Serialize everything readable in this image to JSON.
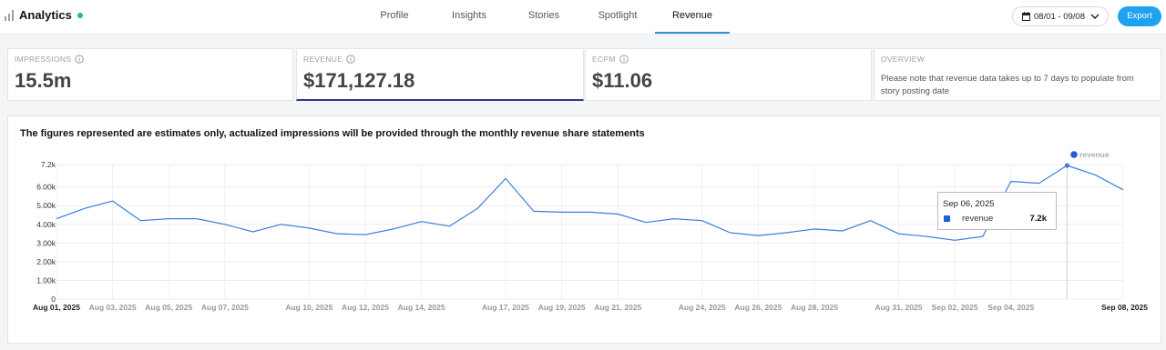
{
  "app": {
    "title": "Analytics",
    "status_color": "#1fb89a",
    "icons": {
      "brand": "bar-chart-icon",
      "calendar": "calendar-icon",
      "chevron": "chevron-down-icon",
      "info": "info-icon"
    }
  },
  "nav": {
    "tabs": [
      {
        "label": "Profile",
        "active": false
      },
      {
        "label": "Insights",
        "active": false
      },
      {
        "label": "Stories",
        "active": false
      },
      {
        "label": "Spotlight",
        "active": false
      },
      {
        "label": "Revenue",
        "active": true
      }
    ]
  },
  "toolbar": {
    "date_range": "08/01 - 09/08",
    "export_label": "Export",
    "accent_color": "#1fa3f0"
  },
  "stats": [
    {
      "label": "IMPRESSIONS",
      "value": "15.5m"
    },
    {
      "label": "REVENUE",
      "value": "$171,127.18",
      "active": true
    },
    {
      "label": "ECPM",
      "value": "$11.06"
    }
  ],
  "overview": {
    "label": "OVERVIEW",
    "text": "Please note that revenue data takes up to 7 days to populate from story posting date"
  },
  "panel": {
    "title": "The figures represented are estimates only, actualized impressions will be provided through the monthly revenue share statements"
  },
  "tooltip": {
    "date": "Sep 06, 2025",
    "series": "revenue",
    "value": "7.2k"
  },
  "chart_data": {
    "type": "line",
    "line_color": "#3a7fd8",
    "y_ticks": [
      "0",
      "1.00k",
      "2.00k",
      "3.00k",
      "4.00k",
      "5.00k",
      "6.00k",
      "7.2k"
    ],
    "ylim": [
      0,
      7200
    ],
    "x_ticks": [
      "Aug 01, 2025",
      "Aug 03, 2025",
      "Aug 05, 2025",
      "Aug 07, 2025",
      "Aug 10, 2025",
      "Aug 12, 2025",
      "Aug 14, 2025",
      "Aug 17, 2025",
      "Aug 19, 2025",
      "Aug 21, 2025",
      "Aug 24, 2025",
      "Aug 26, 2025",
      "Aug 28, 2025",
      "Aug 31, 2025",
      "Sep 02, 2025",
      "Sep 04, 2025",
      "Sep 08, 2025"
    ],
    "legend": "top-right",
    "series": [
      {
        "name": "revenue",
        "x": [
          "Aug 01, 2025",
          "Aug 02, 2025",
          "Aug 03, 2025",
          "Aug 04, 2025",
          "Aug 05, 2025",
          "Aug 06, 2025",
          "Aug 07, 2025",
          "Aug 08, 2025",
          "Aug 09, 2025",
          "Aug 10, 2025",
          "Aug 11, 2025",
          "Aug 12, 2025",
          "Aug 13, 2025",
          "Aug 14, 2025",
          "Aug 15, 2025",
          "Aug 16, 2025",
          "Aug 17, 2025",
          "Aug 18, 2025",
          "Aug 19, 2025",
          "Aug 20, 2025",
          "Aug 21, 2025",
          "Aug 22, 2025",
          "Aug 23, 2025",
          "Aug 24, 2025",
          "Aug 25, 2025",
          "Aug 26, 2025",
          "Aug 27, 2025",
          "Aug 28, 2025",
          "Aug 29, 2025",
          "Aug 30, 2025",
          "Aug 31, 2025",
          "Sep 01, 2025",
          "Sep 02, 2025",
          "Sep 03, 2025",
          "Sep 04, 2025",
          "Sep 05, 2025",
          "Sep 06, 2025",
          "Sep 07, 2025",
          "Sep 08, 2025"
        ],
        "values": [
          4300,
          4850,
          5250,
          4200,
          4300,
          4300,
          4000,
          3600,
          4000,
          3800,
          3500,
          3450,
          3750,
          4150,
          3900,
          4850,
          6450,
          4700,
          4650,
          4650,
          4550,
          4100,
          4300,
          4200,
          3550,
          3400,
          3550,
          3750,
          3650,
          4200,
          3500,
          3350,
          3150,
          3350,
          6300,
          6200,
          7150,
          6650,
          5850
        ]
      }
    ]
  }
}
